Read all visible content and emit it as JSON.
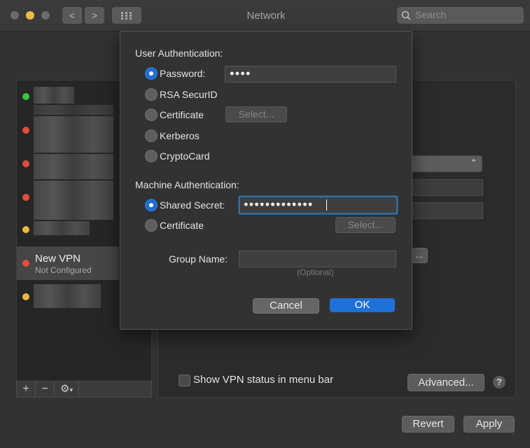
{
  "window": {
    "title": "Network",
    "search_placeholder": "Search"
  },
  "nav": {
    "back": "<",
    "forward": ">"
  },
  "sidebar": {
    "status_colors": {
      "connected": "#34c74a",
      "not_connected": "#e74c3c",
      "inactive": "#f0b83a"
    },
    "items": [
      {
        "status": "green"
      },
      {
        "status": "red"
      },
      {
        "status": "red"
      },
      {
        "status": "red"
      },
      {
        "status": "yellow"
      },
      {
        "status": "red",
        "name": "New VPN",
        "subtitle": "Not Configured"
      },
      {
        "status": "yellow"
      }
    ],
    "add_label": "+",
    "remove_label": "−",
    "gear_label": "⚙"
  },
  "panel": {
    "select_button": "...",
    "show_status_label": "Show VPN status in menu bar",
    "advanced_label": "Advanced...",
    "help_label": "?"
  },
  "footer": {
    "revert_label": "Revert",
    "apply_label": "Apply"
  },
  "dialog": {
    "user_auth_heading": "User Authentication:",
    "user_options": [
      "Password:",
      "RSA SecurID",
      "Certificate",
      "Kerberos",
      "CryptoCard"
    ],
    "password_value": "●●●●",
    "user_cert_select": "Select...",
    "machine_auth_heading": "Machine Authentication:",
    "machine_options": [
      "Shared Secret:",
      "Certificate"
    ],
    "shared_secret_value": "●●●●●●●●●●●●●",
    "machine_cert_select": "Select...",
    "group_name_label": "Group Name:",
    "group_name_hint": "(Optional)",
    "cancel_label": "Cancel",
    "ok_label": "OK"
  },
  "colors": {
    "accent": "#1f70d8",
    "window_bg": "#323232"
  }
}
